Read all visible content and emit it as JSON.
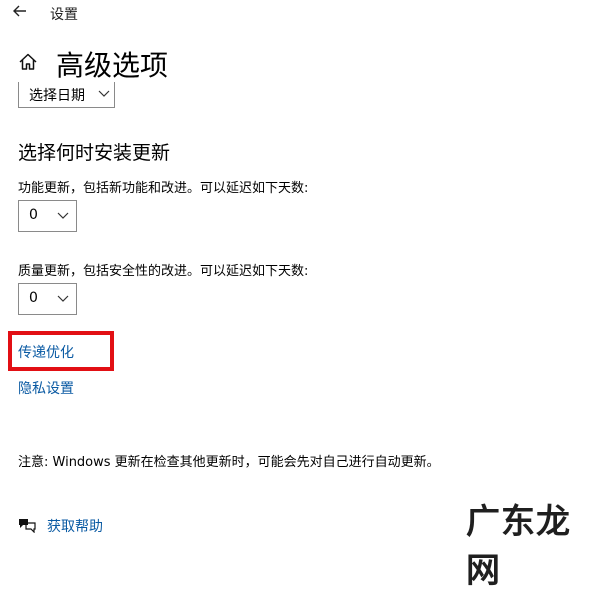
{
  "titlebar": {
    "back_icon": "arrow-left-icon",
    "title": "设置"
  },
  "page": {
    "home_icon": "home-icon",
    "title": "高级选项"
  },
  "pause_section": {
    "date_dropdown_label": "选择日期"
  },
  "update_section": {
    "heading": "选择何时安装更新",
    "feature_label": "功能更新，包括新功能和改进。可以延迟如下天数:",
    "feature_value": "0",
    "quality_label": "质量更新，包括安全性的改进。可以延迟如下天数:",
    "quality_value": "0"
  },
  "links": {
    "delivery_optimization": "传递优化",
    "privacy_settings": "隐私设置"
  },
  "highlight_color": "#e20f14",
  "link_color": "#0a5aa3",
  "note": "注意: Windows 更新在检查其他更新时，可能会先对自己进行自动更新。",
  "help": {
    "icon": "chat-help-icon",
    "label": "获取帮助"
  },
  "watermark": "广东龙网"
}
